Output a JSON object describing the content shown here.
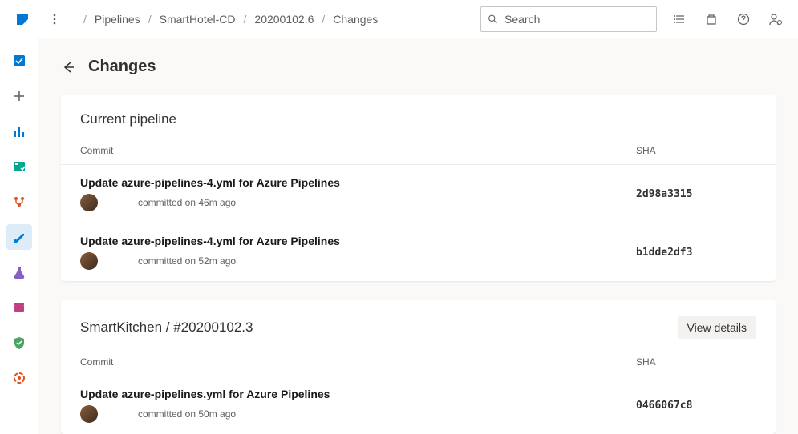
{
  "breadcrumb": {
    "items": [
      "Pipelines",
      "SmartHotel-CD",
      "20200102.6",
      "Changes"
    ]
  },
  "search": {
    "placeholder": "Search"
  },
  "page": {
    "title": "Changes"
  },
  "sections": [
    {
      "title": "Current pipeline",
      "view_details": null,
      "columns": {
        "commit": "Commit",
        "sha": "SHA"
      },
      "commits": [
        {
          "title": "Update azure-pipelines-4.yml for Azure Pipelines",
          "meta": "committed on 46m ago",
          "sha": "2d98a3315"
        },
        {
          "title": "Update azure-pipelines-4.yml for Azure Pipelines",
          "meta": "committed on 52m ago",
          "sha": "b1dde2df3"
        }
      ]
    },
    {
      "title": "SmartKitchen / #20200102.3",
      "view_details": "View details",
      "columns": {
        "commit": "Commit",
        "sha": "SHA"
      },
      "commits": [
        {
          "title": "Update azure-pipelines.yml for Azure Pipelines",
          "meta": "committed on 50m ago",
          "sha": "0466067c8"
        }
      ]
    }
  ],
  "rail": {
    "icons": [
      "azure-devops-icon",
      "plus-icon",
      "chart-icon",
      "boards-icon",
      "repos-icon",
      "pipelines-icon",
      "test-plans-icon",
      "artifacts-icon",
      "shield-icon",
      "gear-red-icon"
    ]
  }
}
